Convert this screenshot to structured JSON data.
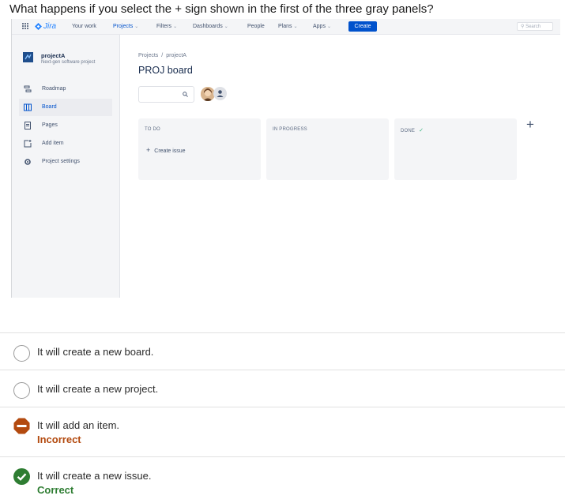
{
  "question": "What happens if you select the + sign shown in the first of the three gray panels?",
  "screenshot": {
    "topnav": {
      "logo": "Jira",
      "items": [
        {
          "label": "Your work",
          "dropdown": false
        },
        {
          "label": "Projects",
          "dropdown": true
        },
        {
          "label": "Filters",
          "dropdown": true
        },
        {
          "label": "Dashboards",
          "dropdown": true
        },
        {
          "label": "People",
          "dropdown": false
        },
        {
          "label": "Plans",
          "dropdown": true
        },
        {
          "label": "Apps",
          "dropdown": true
        }
      ],
      "create_label": "Create",
      "search_placeholder": "Search"
    },
    "sidebar": {
      "project_name": "projectA",
      "project_type": "Next-gen software project",
      "items": [
        {
          "label": "Roadmap",
          "icon": "roadmap-icon"
        },
        {
          "label": "Board",
          "icon": "board-icon",
          "selected": true
        },
        {
          "label": "Pages",
          "icon": "pages-icon"
        },
        {
          "label": "Add item",
          "icon": "add-item-icon"
        },
        {
          "label": "Project settings",
          "icon": "gear-icon"
        }
      ]
    },
    "breadcrumb": [
      "Projects",
      "projectA"
    ],
    "breadcrumb_sep": "/",
    "board_title": "PROJ board",
    "columns": [
      {
        "title": "TO DO",
        "create_issue": "Create issue"
      },
      {
        "title": "IN PROGRESS"
      },
      {
        "title": "DONE",
        "check": true
      }
    ],
    "add_column": "+"
  },
  "options": [
    {
      "text": "It will create a new board.",
      "state": "unselected"
    },
    {
      "text": "It will create a new project.",
      "state": "unselected"
    },
    {
      "text": "It will add an item.",
      "state": "incorrect",
      "feedback": "Incorrect"
    },
    {
      "text": "It will create a new issue.",
      "state": "correct",
      "feedback": "Correct"
    }
  ],
  "colors": {
    "incorrect": "#b34a0f",
    "correct": "#2e7d32",
    "jira_blue": "#0052cc"
  }
}
